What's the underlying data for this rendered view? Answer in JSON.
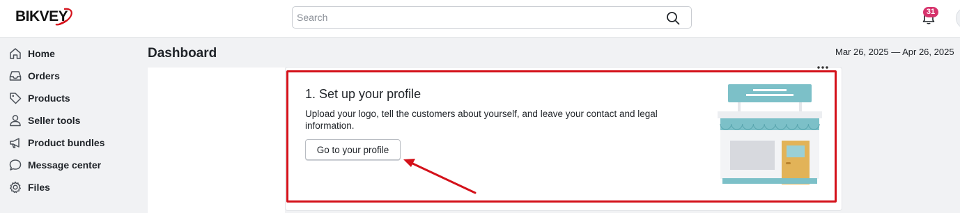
{
  "brand": {
    "logo_text": "BIKVEY",
    "accent": "#d4111a"
  },
  "search": {
    "placeholder": "Search",
    "icon": "search-icon"
  },
  "notifications": {
    "count": "31",
    "icon": "bell-icon",
    "badge_color": "#d6336c"
  },
  "sidebar": {
    "items": [
      {
        "label": "Home",
        "icon": "home-icon"
      },
      {
        "label": "Orders",
        "icon": "inbox-icon"
      },
      {
        "label": "Products",
        "icon": "tag-icon"
      },
      {
        "label": "Seller tools",
        "icon": "user-icon"
      },
      {
        "label": "Product bundles",
        "icon": "megaphone-icon"
      },
      {
        "label": "Message center",
        "icon": "chat-icon"
      },
      {
        "label": "Files",
        "icon": "gear-icon"
      }
    ]
  },
  "main": {
    "title": "Dashboard",
    "date_range": "Mar 26, 2025 — Apr 26, 2025"
  },
  "onboarding_card": {
    "title": "1. Set up your profile",
    "description": "Upload your logo, tell the customers about yourself, and leave your contact and legal information.",
    "button_label": "Go to your profile",
    "illustration": "storefront-illustration",
    "menu_icon": "more-horizontal-icon",
    "highlight_color": "#d4111a"
  }
}
